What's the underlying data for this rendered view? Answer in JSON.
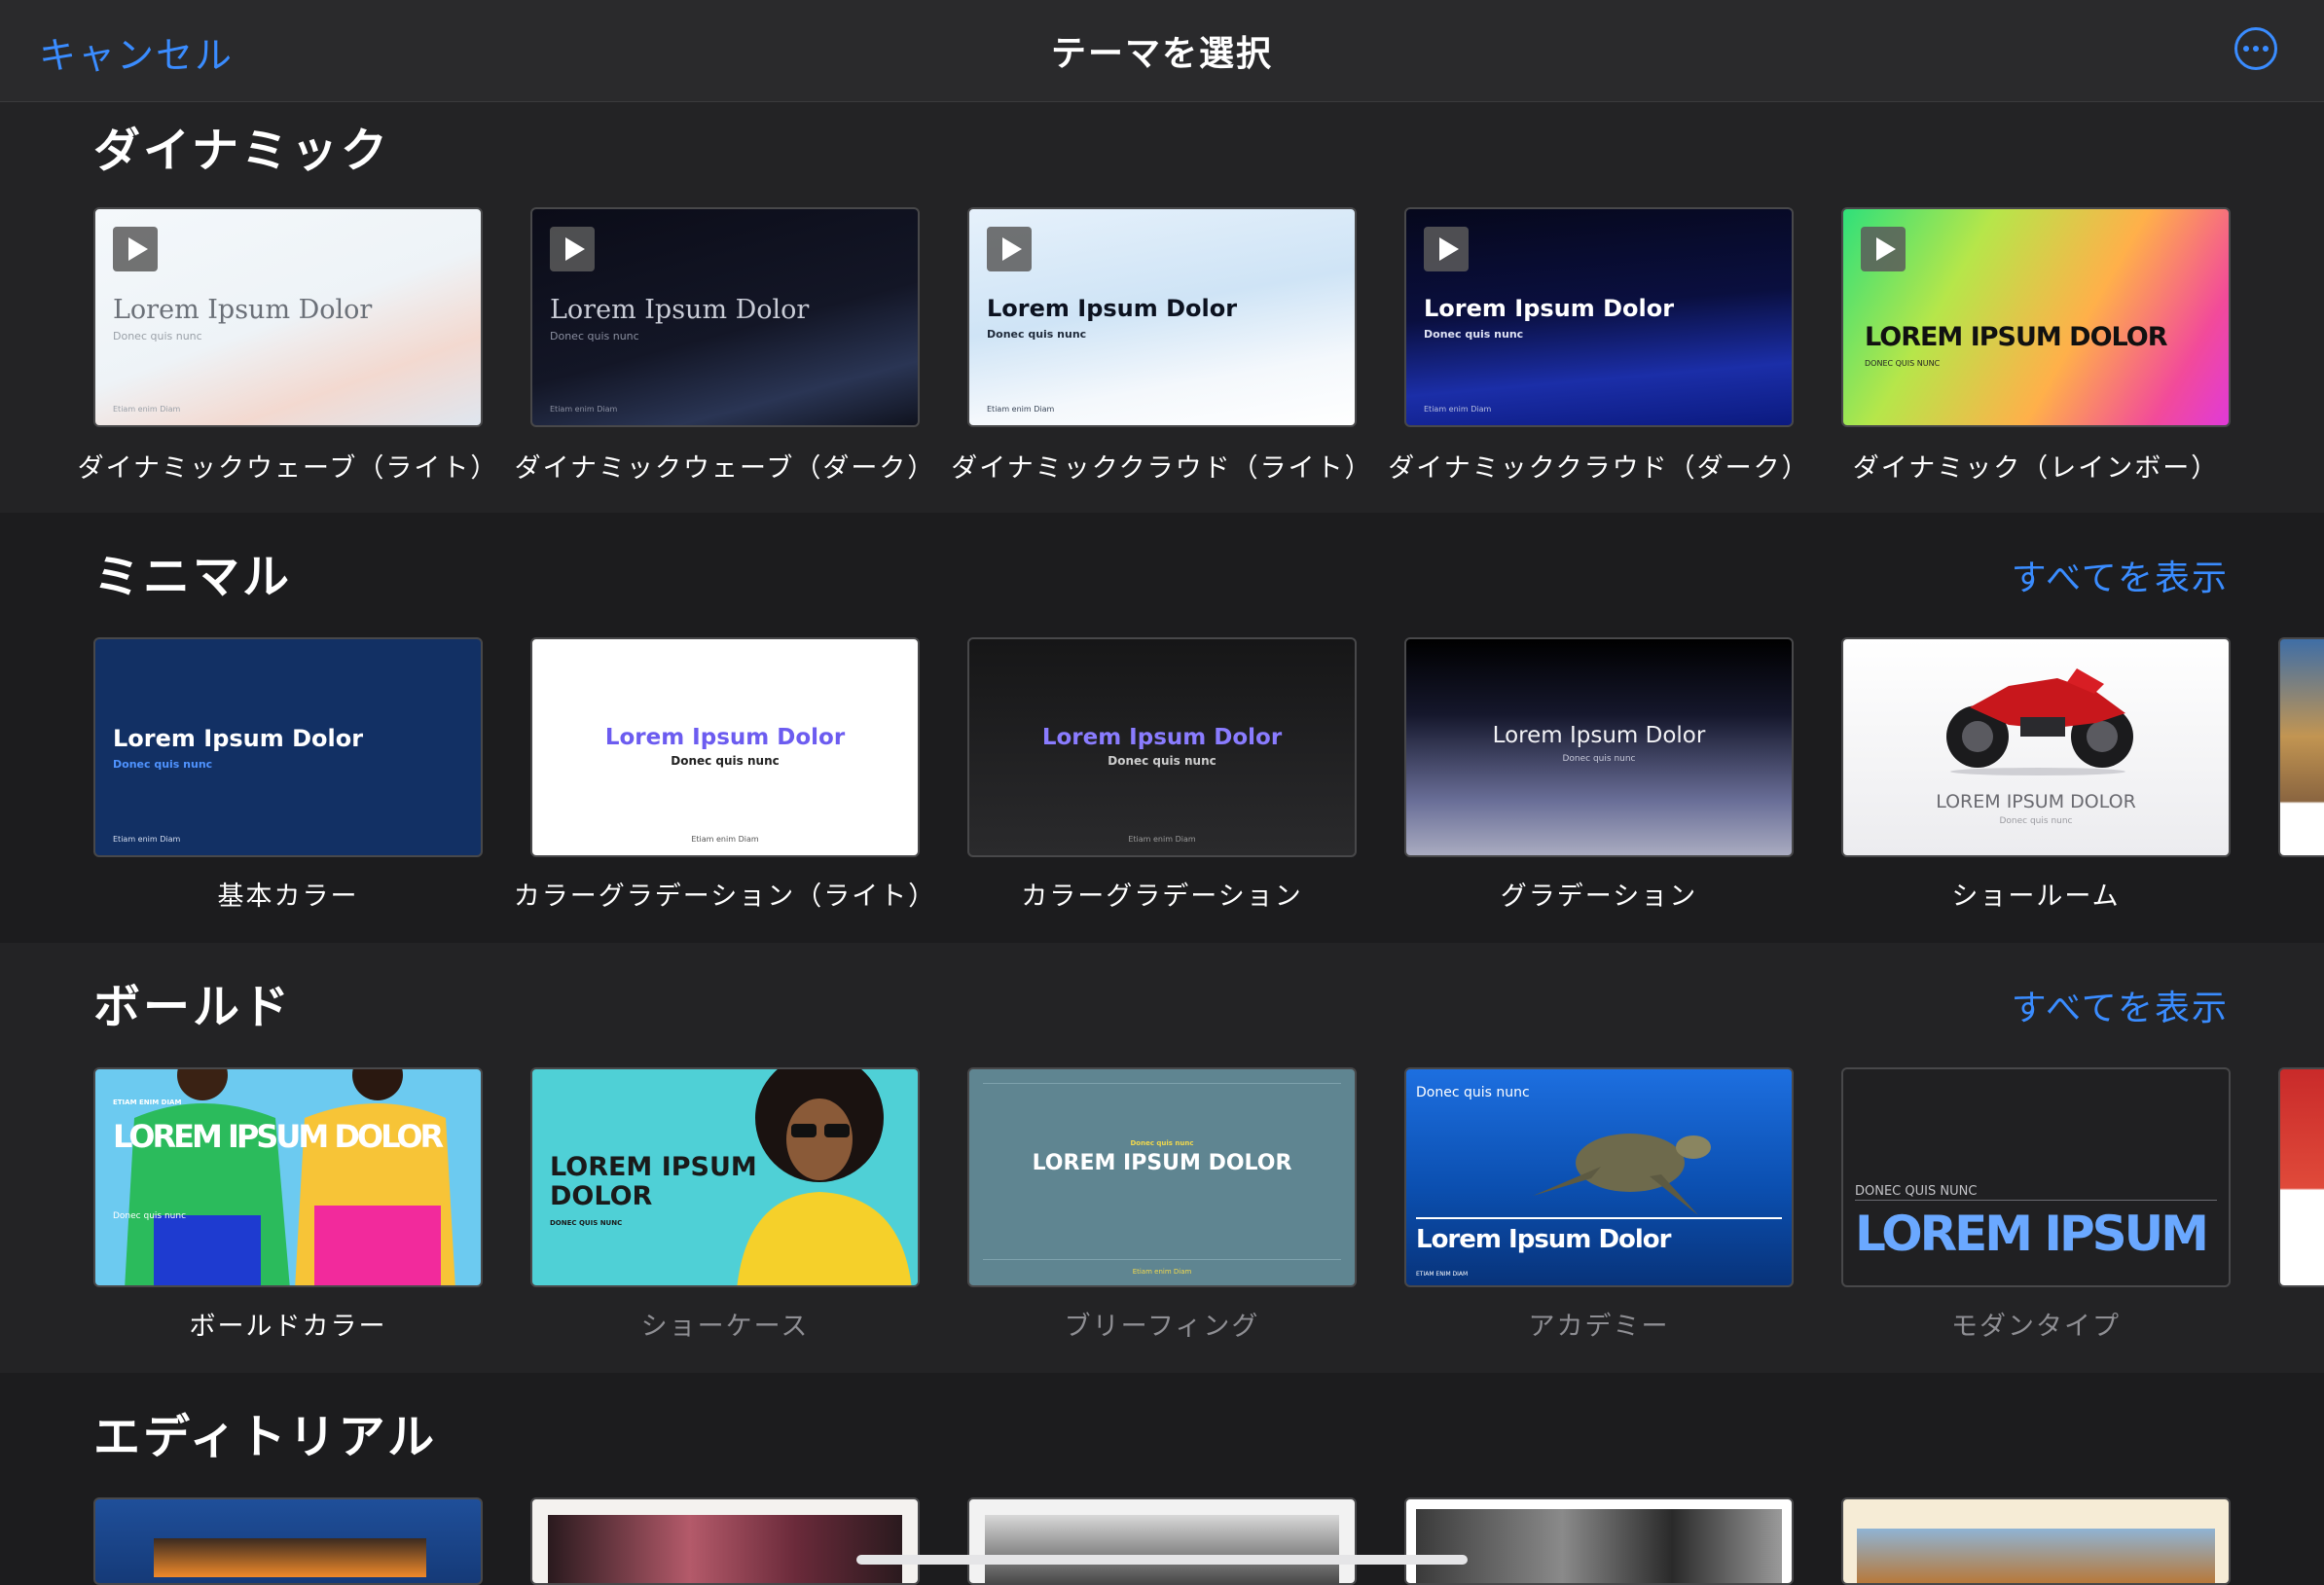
{
  "nav": {
    "cancel": "キャンセル",
    "title": "テーマを選択",
    "more_icon": "ellipsis-circle-icon"
  },
  "sections": [
    {
      "title": "ダイナミック",
      "see_all": "",
      "themes": [
        {
          "name": "ダイナミックウェーブ（ライト）",
          "title": "Lorem Ipsum Dolor",
          "subtitle": "Donec quis nunc",
          "footer": "Etiam enim Diam"
        },
        {
          "name": "ダイナミックウェーブ（ダーク）",
          "title": "Lorem Ipsum Dolor",
          "subtitle": "Donec quis nunc",
          "footer": "Etiam enim Diam"
        },
        {
          "name": "ダイナミッククラウド（ライト）",
          "title": "Lorem Ipsum Dolor",
          "subtitle": "Donec quis nunc",
          "footer": "Etiam enim Diam"
        },
        {
          "name": "ダイナミッククラウド（ダーク）",
          "title": "Lorem Ipsum Dolor",
          "subtitle": "Donec quis nunc",
          "footer": "Etiam enim Diam"
        },
        {
          "name": "ダイナミック（レインボー）",
          "title": "LOREM IPSUM DOLOR",
          "subtitle": "DONEC QUIS NUNC",
          "footer": ""
        }
      ]
    },
    {
      "title": "ミニマル",
      "see_all": "すべてを表示",
      "themes": [
        {
          "name": "基本カラー",
          "title": "Lorem Ipsum Dolor",
          "subtitle": "Donec quis nunc",
          "footer": "Etiam enim Diam"
        },
        {
          "name": "カラーグラデーション（ライト）",
          "title": "Lorem Ipsum Dolor",
          "subtitle": "Donec quis nunc",
          "footer": "Etiam enim Diam"
        },
        {
          "name": "カラーグラデーション",
          "title": "Lorem Ipsum Dolor",
          "subtitle": "Donec quis nunc",
          "footer": "Etiam enim Diam"
        },
        {
          "name": "グラデーション",
          "title": "Lorem Ipsum Dolor",
          "subtitle": "Donec quis nunc",
          "footer": ""
        },
        {
          "name": "ショールーム",
          "title": "LOREM IPSUM DOLOR",
          "subtitle": "Donec quis nunc",
          "footer": ""
        }
      ]
    },
    {
      "title": "ボールド",
      "see_all": "すべてを表示",
      "themes": [
        {
          "name": "ボールドカラー",
          "title": "LOREM IPSUM DOLOR",
          "subtitle": "Donec quis nunc",
          "footer": "ETIAM ENIM DIAM"
        },
        {
          "name": "ショーケース",
          "title": "LOREM IPSUM DOLOR",
          "subtitle": "DONEC QUIS NUNC",
          "footer": ""
        },
        {
          "name": "ブリーフィング",
          "title": "LOREM IPSUM DOLOR",
          "subtitle": "Donec quis nunc",
          "footer": "Etiam enim Diam"
        },
        {
          "name": "アカデミー",
          "title": "Lorem Ipsum Dolor",
          "subtitle": "Donec quis nunc",
          "footer": "ETIAM ENIM DIAM"
        },
        {
          "name": "モダンタイプ",
          "title": "LOREM IPSUM",
          "subtitle": "DONEC QUIS NUNC",
          "footer": ""
        }
      ]
    },
    {
      "title": "エディトリアル",
      "see_all": "",
      "themes": []
    }
  ]
}
